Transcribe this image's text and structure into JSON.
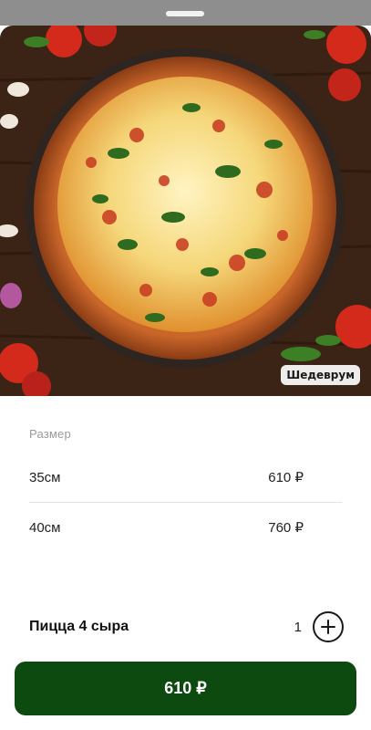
{
  "image": {
    "watermark": "Шедеврум"
  },
  "sizes": {
    "label": "Размер",
    "options": [
      {
        "name": "35см",
        "price": "610 ₽"
      },
      {
        "name": "40см",
        "price": "760 ₽"
      }
    ]
  },
  "product": {
    "name": "Пицца 4 сыра",
    "quantity": "1"
  },
  "cta": {
    "label": "610 ₽"
  },
  "colors": {
    "accent": "#0d4a10",
    "background": "#ffffff",
    "divider": "#e3e3e3"
  },
  "icons": {
    "add": "plus-circle-icon"
  }
}
